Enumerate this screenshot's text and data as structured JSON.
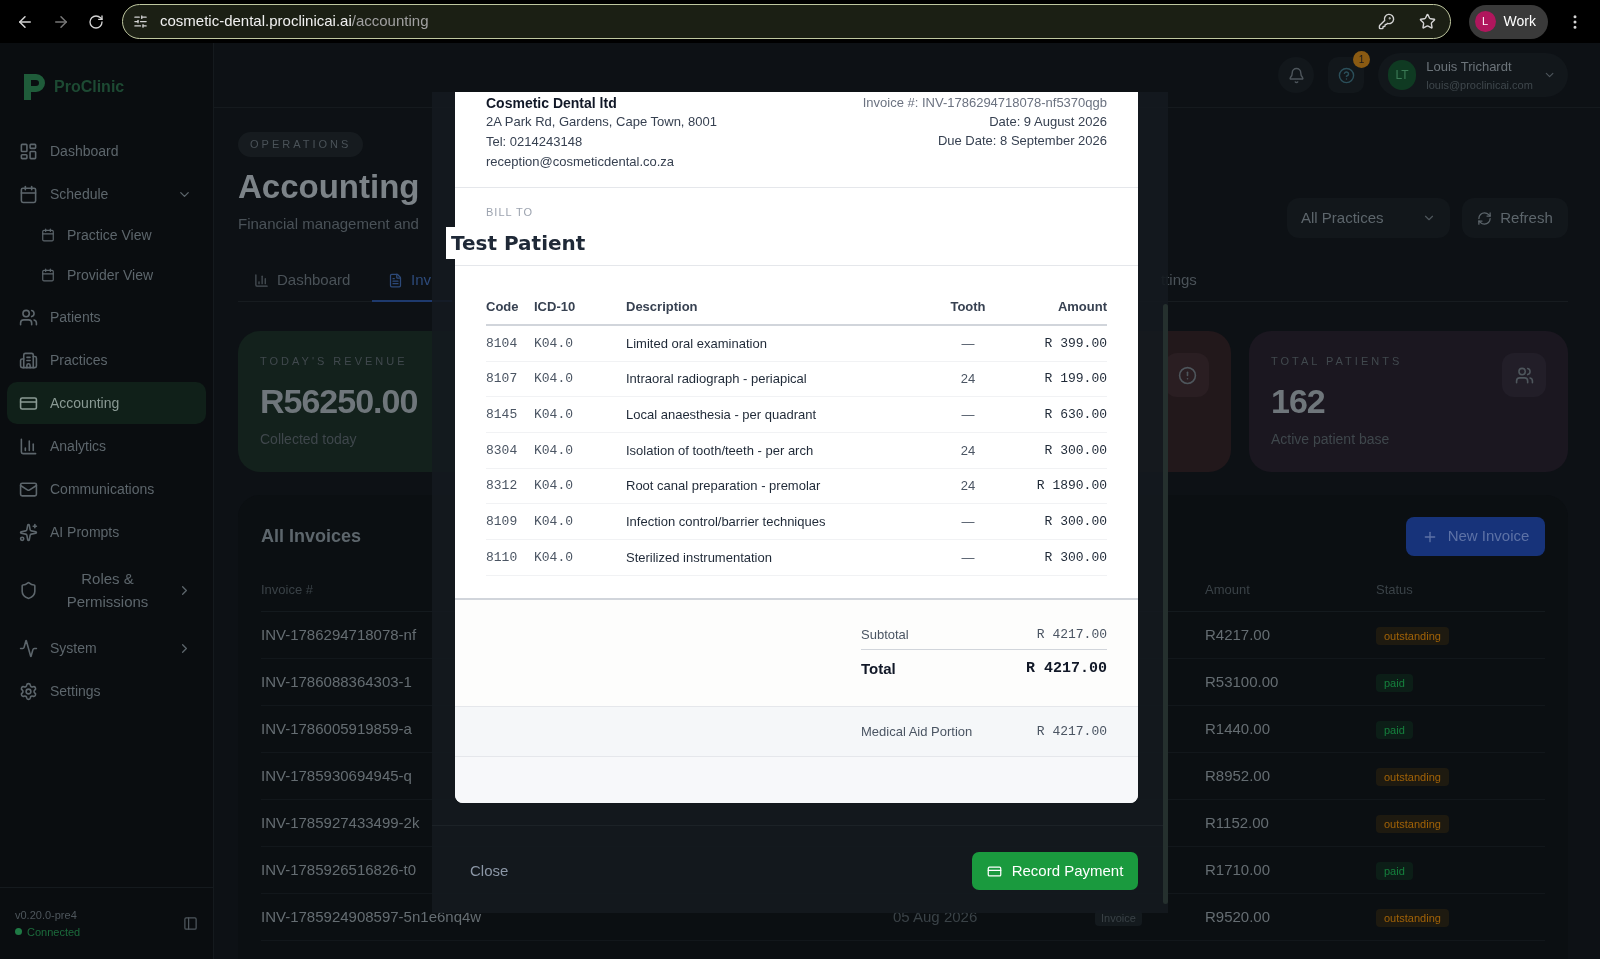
{
  "browser": {
    "url_host": "cosmetic-dental.proclinicai.ai",
    "url_path": "/accounting",
    "profile_initial": "L",
    "profile_label": "Work"
  },
  "sidebar": {
    "logo": "ProClinic",
    "items": [
      {
        "label": "Dashboard",
        "selected": false
      },
      {
        "label": "Schedule",
        "selected": false,
        "expanded": true,
        "children": [
          {
            "label": "Practice View",
            "selected": false
          },
          {
            "label": "Provider View",
            "selected": false
          }
        ]
      },
      {
        "label": "Patients",
        "selected": false
      },
      {
        "label": "Practices",
        "selected": false
      },
      {
        "label": "Accounting",
        "selected": true
      },
      {
        "label": "Analytics",
        "selected": false
      },
      {
        "label": "Communications",
        "selected": false
      },
      {
        "label": "AI Prompts",
        "selected": false
      },
      {
        "label": "Roles & Permissions",
        "selected": false,
        "expanded": false
      },
      {
        "label": "System",
        "selected": false,
        "expanded": false
      },
      {
        "label": "Settings",
        "selected": false
      }
    ],
    "version": "v0.20.0-pre4",
    "status": "Connected",
    "connected": true
  },
  "header": {
    "notification_count": "1",
    "user_initials": "LT",
    "user_name": "Louis Trichardt",
    "user_email": "louis@proclinicai.com"
  },
  "page": {
    "eyebrow": "OPERATIONS",
    "title": "Accounting",
    "subtitle": "Financial management and",
    "practice_select": "All Practices",
    "refresh": "Refresh"
  },
  "tabs": [
    {
      "label": "Dashboard",
      "selected": false
    },
    {
      "label": "Inv",
      "selected": true
    },
    {
      "label": "ttings",
      "selected": false
    }
  ],
  "stats": [
    {
      "kind": "full",
      "label": "TODAY'S REVENUE",
      "value": "R56250.00",
      "caption": "Collected today",
      "color": "#13211c"
    },
    {
      "kind": "hidden"
    },
    {
      "kind": "icon_only",
      "color": "#22181b"
    },
    {
      "kind": "full",
      "label": "TOTAL PATIENTS",
      "value": "162",
      "caption": "Active patient base",
      "color": "#1b1720"
    }
  ],
  "invoices": {
    "title": "All Invoices",
    "new_button": "New Invoice",
    "columns": {
      "invoice": "Invoice #",
      "amount": "Amount",
      "status": "Status"
    },
    "rows": [
      {
        "invoice": "INV-1786294718078-nf",
        "amount": "R4217.00",
        "status": "outstanding",
        "color": "#a16207"
      },
      {
        "invoice": "INV-1786088364303-1",
        "amount": "R53100.00",
        "status": "paid",
        "color": "#15803d"
      },
      {
        "invoice": "INV-1786005919859-a",
        "amount": "R1440.00",
        "status": "paid",
        "color": "#15803d"
      },
      {
        "invoice": "INV-1785930694945-q",
        "amount": "R8952.00",
        "status": "outstanding",
        "color": "#a16207"
      },
      {
        "invoice": "INV-1785927433499-2k",
        "amount": "R1152.00",
        "status": "outstanding",
        "color": "#a16207"
      },
      {
        "invoice": "INV-1785926516826-t0",
        "amount": "R1710.00",
        "status": "paid",
        "color": "#15803d"
      },
      {
        "invoice": "INV-1785924908597-5n1e6nq4w",
        "date": "05 Aug 2026",
        "type": "Invoice",
        "amount": "R9520.00",
        "status": "outstanding",
        "color": "#a16207"
      }
    ]
  },
  "modal": {
    "company": "Cosmetic Dental ltd",
    "address_lines": [
      "2A Park Rd, Gardens, Cape Town, 8001",
      "Tel: 0214243148",
      "reception@cosmeticdental.co.za"
    ],
    "invoice_no": "Invoice #: INV-1786294718078-nf5370qgb",
    "date": "Date: 9 August 2026",
    "due": "Due Date: 8 September 2026",
    "bill_to_label": "BILL TO",
    "patient": "Test Patient",
    "columns": [
      "Code",
      "ICD-10",
      "Description",
      "Tooth",
      "Amount"
    ],
    "lines": [
      {
        "code": "8104",
        "icd": "K04.0",
        "description": "Limited oral examination",
        "tooth": "—",
        "amount": "R 399.00"
      },
      {
        "code": "8107",
        "icd": "K04.0",
        "description": "Intraoral radiograph - periapical",
        "tooth": "24",
        "amount": "R 199.00"
      },
      {
        "code": "8145",
        "icd": "K04.0",
        "description": "Local anaesthesia - per quadrant",
        "tooth": "—",
        "amount": "R 630.00"
      },
      {
        "code": "8304",
        "icd": "K04.0",
        "description": "Isolation of tooth/teeth - per arch",
        "tooth": "24",
        "amount": "R 300.00"
      },
      {
        "code": "8312",
        "icd": "K04.0",
        "description": "Root canal preparation - premolar",
        "tooth": "24",
        "amount": "R 1890.00"
      },
      {
        "code": "8109",
        "icd": "K04.0",
        "description": "Infection control/barrier techniques",
        "tooth": "—",
        "amount": "R 300.00"
      },
      {
        "code": "8110",
        "icd": "K04.0",
        "description": "Sterilized instrumentation",
        "tooth": "—",
        "amount": "R 300.00"
      }
    ],
    "subtotal_label": "Subtotal",
    "subtotal": "R 4217.00",
    "total_label": "Total",
    "total": "R 4217.00",
    "aid_label": "Medical Aid Portion",
    "aid": "R 4217.00",
    "close": "Close",
    "record": "Record Payment"
  }
}
